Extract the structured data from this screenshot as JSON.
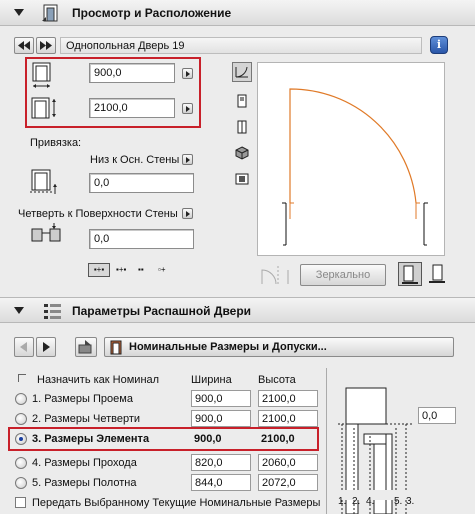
{
  "section1": {
    "title": "Просмотр и Расположение"
  },
  "door_name": "Однопольная Дверь 19",
  "width_value": "900,0",
  "height_value": "2100,0",
  "anchor": {
    "label": "Привязка:",
    "dropdown": "Низ к Осн. Стены",
    "value": "0,0"
  },
  "rebate": {
    "dropdown": "Четверть к Поверхности Стены",
    "value": "0,0"
  },
  "mirror_label": "Зеркально",
  "section2": {
    "title": "Параметры Распашной Двери"
  },
  "panel_title": "Номинальные Размеры и Допуски...",
  "table": {
    "nominal_checkbox": "Назначить как Номинал",
    "col_width": "Ширина",
    "col_height": "Высота",
    "rows": [
      {
        "label": "1. Размеры Проема",
        "w": "900,0",
        "h": "2100,0"
      },
      {
        "label": "2. Размеры Четверти",
        "w": "900,0",
        "h": "2100,0"
      },
      {
        "label": "3. Размеры Элемента",
        "w": "900,0",
        "h": "2100,0"
      },
      {
        "label": "4. Размеры Прохода",
        "w": "820,0",
        "h": "2060,0"
      },
      {
        "label": "5. Размеры Полотна",
        "w": "844,0",
        "h": "2072,0"
      }
    ],
    "transfer_label": "Передать Выбранному Текущие Номинальные Размеры"
  },
  "side_value": "0,0",
  "diagram_labels": [
    "1.",
    "2.",
    "4.",
    "5.",
    "3."
  ],
  "colors": {
    "swing_arc": "#e07a28",
    "highlight": "#c8202a",
    "radio_on": "#1a3fa0"
  }
}
